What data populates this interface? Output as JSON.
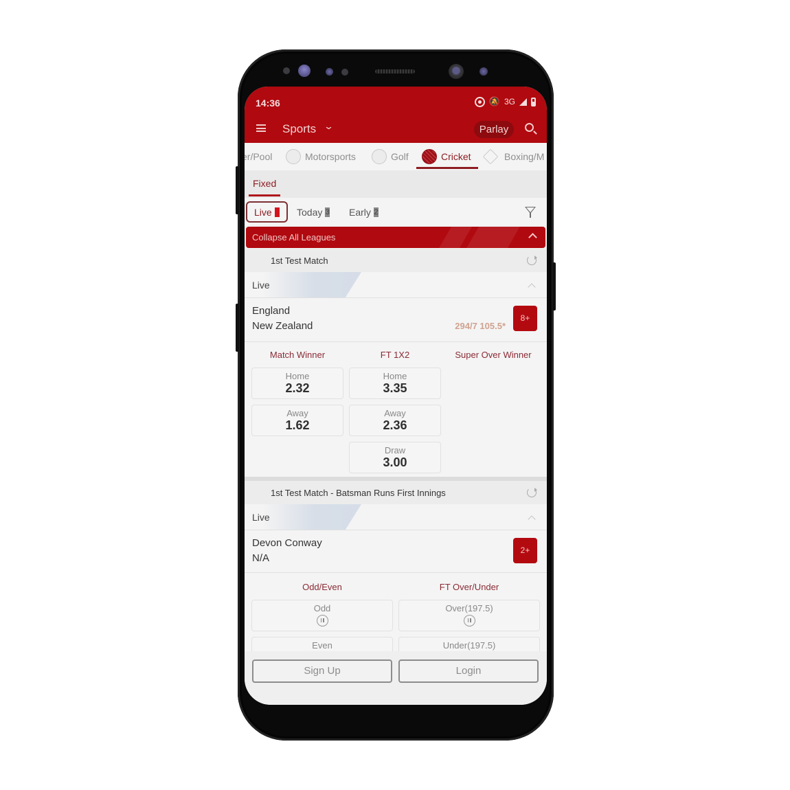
{
  "status_bar": {
    "time": "14:36",
    "network": "3G",
    "icons": [
      "data-saver-icon",
      "bell-off-icon",
      "signal-icon",
      "battery-icon"
    ]
  },
  "header": {
    "menu_icon": "hamburger-menu-icon",
    "title": "Sports",
    "title_chevron": "chevron-down-icon",
    "parlay_label": "Parlay",
    "search_icon": "search-icon"
  },
  "sport_tabs": [
    {
      "label": "er/Pool",
      "icon": null,
      "active": false
    },
    {
      "label": "Motorsports",
      "icon": "helmet-icon",
      "active": false
    },
    {
      "label": "Golf",
      "icon": "golf-ball-icon",
      "active": false
    },
    {
      "label": "Cricket",
      "icon": "cricket-ball-icon",
      "active": true
    },
    {
      "label": "Boxing/M",
      "icon": "boxing-glove-icon",
      "active": false
    }
  ],
  "odds_type_tab": {
    "label": "Fixed",
    "active": true
  },
  "filters": [
    {
      "label": "Live",
      "count": "1",
      "active": true
    },
    {
      "label": "Today",
      "count": "3",
      "active": false
    },
    {
      "label": "Early",
      "count": "2",
      "active": false
    }
  ],
  "filter_icon": "filter-funnel-icon",
  "accent_color": "#b0090f",
  "collapse_all_label": "Collapse All Leagues",
  "leagues": [
    {
      "title": "1st Test Match",
      "state_label": "Live",
      "participants": [
        "England",
        "New Zealand"
      ],
      "score": "294/7 105.5*",
      "more_markets": "8+",
      "markets": [
        {
          "title": "Match Winner",
          "selections": [
            {
              "label": "Home",
              "odds": "2.32"
            },
            {
              "label": "Away",
              "odds": "1.62"
            }
          ]
        },
        {
          "title": "FT 1X2",
          "selections": [
            {
              "label": "Home",
              "odds": "3.35"
            },
            {
              "label": "Away",
              "odds": "2.36"
            },
            {
              "label": "Draw",
              "odds": "3.00"
            }
          ]
        },
        {
          "title": "Super Over Winner",
          "selections": []
        }
      ]
    },
    {
      "title": "1st Test Match - Batsman Runs First Innings",
      "state_label": "Live",
      "participants": [
        "Devon Conway",
        "N/A"
      ],
      "more_markets": "2+",
      "markets": [
        {
          "title": "Odd/Even",
          "selections": [
            {
              "label": "Odd",
              "status": "suspended"
            },
            {
              "label": "Even",
              "status": "suspended"
            }
          ]
        },
        {
          "title": "FT Over/Under",
          "selections": [
            {
              "label": "Over(197.5)",
              "status": "suspended"
            },
            {
              "label": "Under(197.5)",
              "status": "suspended"
            }
          ]
        }
      ]
    }
  ],
  "auth": {
    "signup_label": "Sign Up",
    "login_label": "Login"
  }
}
